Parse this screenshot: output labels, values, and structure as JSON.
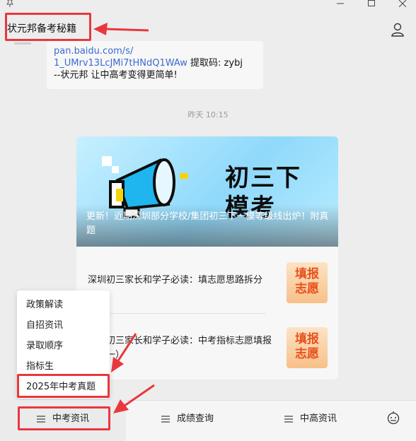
{
  "window": {
    "pin_icon": "pin-icon",
    "min_icon": "minimize-icon",
    "max_icon": "maximize-icon",
    "close_icon": "close-icon"
  },
  "header": {
    "title": "状元邦备考秘籍",
    "profile_icon": "person-icon"
  },
  "message": {
    "link_line1": "pan.baidu.com/s/",
    "link_line2": "1_UMrv13LcJMi7tHNdQ1WAw",
    "code_text": " 提取码: zybj",
    "line3": "--状元邦 让中高考变得更简单!"
  },
  "timestamp": "昨天 10:15",
  "card": {
    "banner_big_line1": "初三下",
    "banner_big_line2": "模考",
    "banner_title": "更新！近期深圳部分学校/集团初三下一模等级线出炉！附真题",
    "items": [
      {
        "text": "深圳初三家长和学子必读：填志愿思路拆分",
        "thumb_line1": "填报",
        "thumb_line2": "志愿"
      },
      {
        "text": "深圳初三家长和学子必读：中考指标志愿填报区（一）",
        "thumb_line1": "填报",
        "thumb_line2": "志愿"
      }
    ]
  },
  "popup_menu": [
    "政策解读",
    "自招资讯",
    "录取顺序",
    "指标生",
    "2025年中考真题"
  ],
  "bottom_tabs": [
    "中考资讯",
    "成绩查询",
    "中高资讯"
  ],
  "bottom_icon": "robot-icon",
  "colors": {
    "highlight": "#e8383d",
    "link": "#3a6bd1",
    "thumb_text": "#e8511d"
  }
}
